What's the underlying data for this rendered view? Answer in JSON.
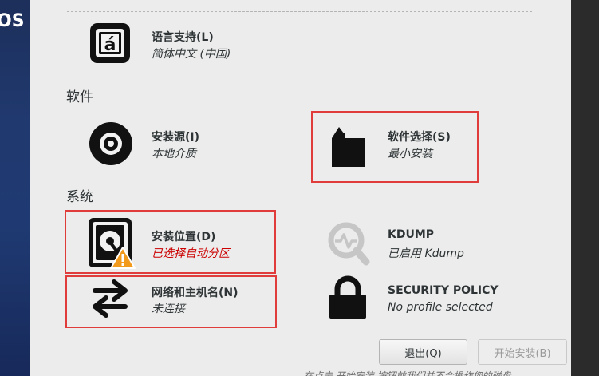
{
  "sidebar": {
    "brand": "OS"
  },
  "sections": {
    "software": "软件",
    "system": "系统"
  },
  "spokes": {
    "language": {
      "title": "语言支持(L)",
      "status": "简体中文 (中国)"
    },
    "source": {
      "title": "安装源(I)",
      "status": "本地介质"
    },
    "software_selection": {
      "title": "软件选择(S)",
      "status": "最小安装"
    },
    "destination": {
      "title": "安装位置(D)",
      "status": "已选择自动分区"
    },
    "kdump": {
      "title": "KDUMP",
      "status": "已启用 Kdump"
    },
    "network": {
      "title": "网络和主机名(N)",
      "status": "未连接"
    },
    "security": {
      "title": "SECURITY POLICY",
      "status": "No profile selected"
    }
  },
  "buttons": {
    "quit": "退出(Q)",
    "begin": "开始安装(B)"
  },
  "footnote": "在点击 开始安装 按钮前我们并不会操作您的磁盘。",
  "colors": {
    "highlight": "#e03c3c",
    "warning": "#cc0000",
    "sidebar": "#203a70"
  },
  "icons": [
    "language-icon",
    "disc-icon",
    "package-icon",
    "harddisk-icon",
    "warning-icon",
    "kdump-search-icon",
    "network-arrows-icon",
    "lock-icon"
  ]
}
